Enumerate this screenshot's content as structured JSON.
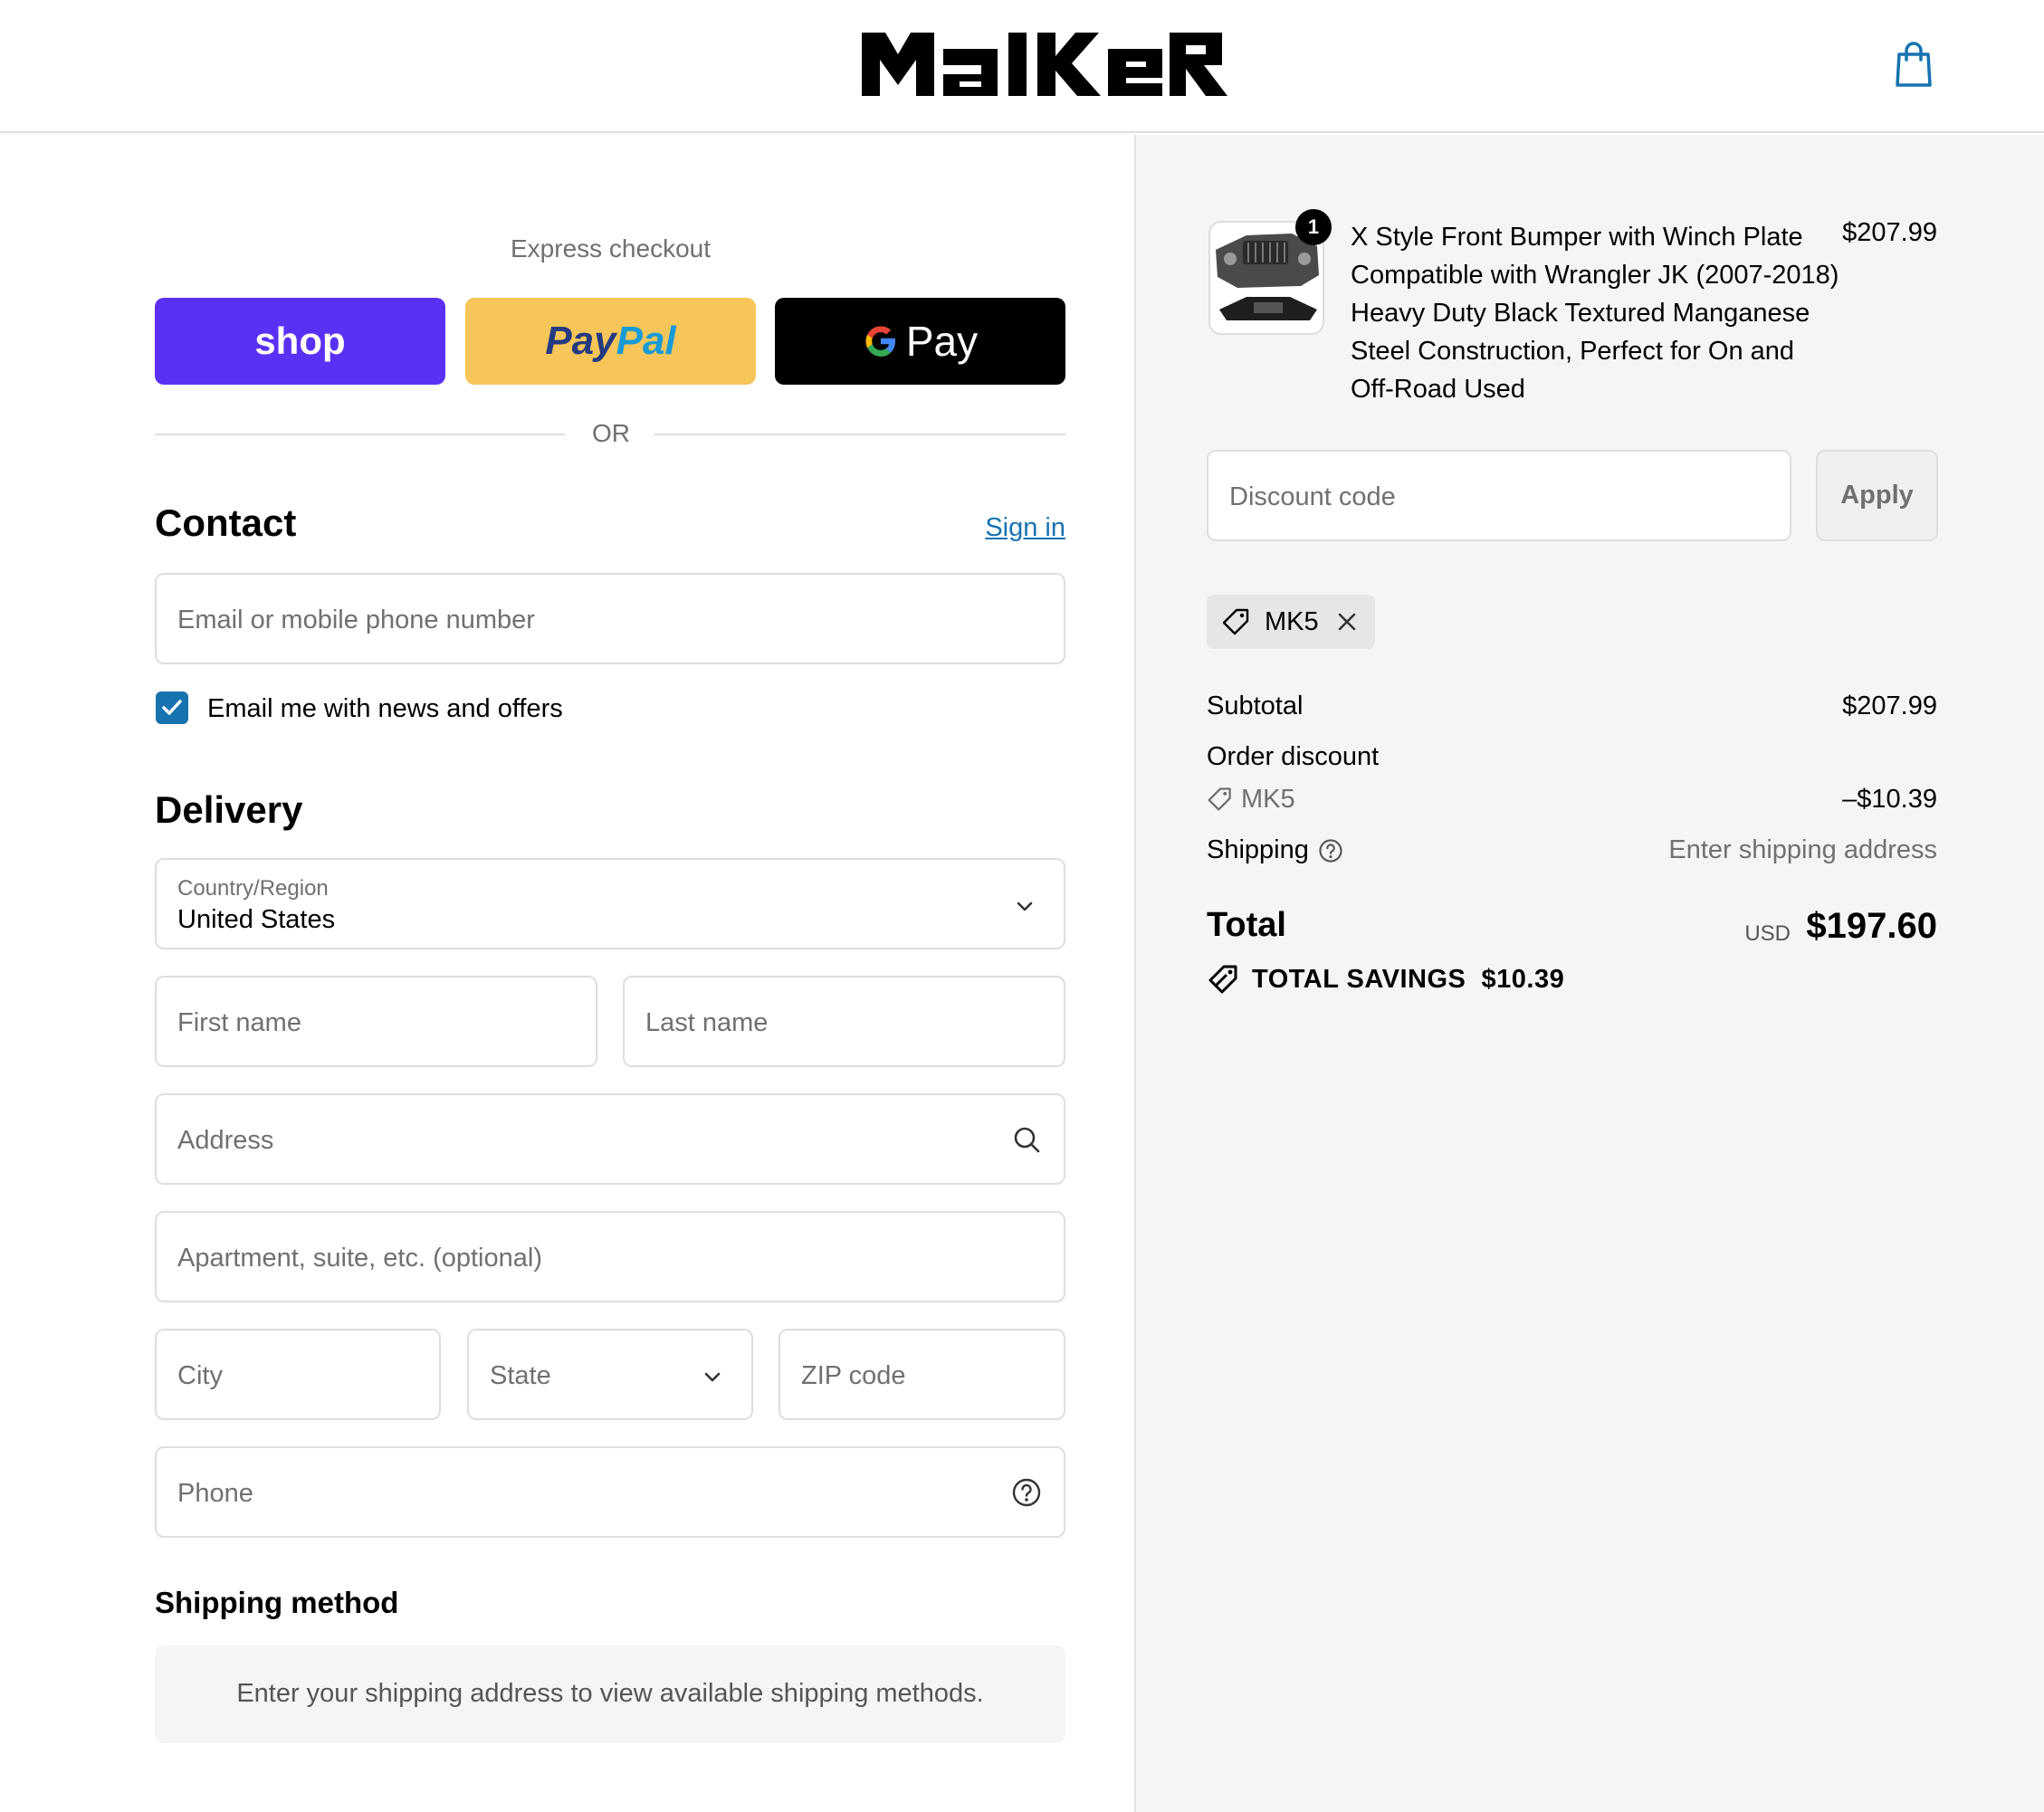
{
  "header": {
    "brand": "MAIKER",
    "cart_icon": "shopping-bag-icon"
  },
  "express": {
    "title": "Express checkout",
    "shop_label": "shop",
    "paypal_label_1": "Pay",
    "paypal_label_2": "Pal",
    "gpay_label": "Pay",
    "or_label": "OR"
  },
  "contact": {
    "heading": "Contact",
    "sign_in": "Sign in",
    "email_placeholder": "Email or mobile phone number",
    "newsletter_label": "Email me with news and offers",
    "newsletter_checked": true
  },
  "delivery": {
    "heading": "Delivery",
    "country_label": "Country/Region",
    "country_value": "United States",
    "first_name": "First name",
    "last_name": "Last name",
    "address": "Address",
    "apartment": "Apartment, suite, etc. (optional)",
    "city": "City",
    "state": "State",
    "zip": "ZIP code",
    "phone": "Phone"
  },
  "shipping_method": {
    "heading": "Shipping method",
    "message": "Enter your shipping address to view available shipping methods."
  },
  "summary": {
    "product": {
      "quantity": "1",
      "title": "X Style Front Bumper with Winch Plate Compatible with Wrangler JK (2007-2018) Heavy Duty Black Textured Manganese Steel Construction, Perfect for On and Off-Road Used",
      "price": "$207.99"
    },
    "discount_placeholder": "Discount code",
    "apply_label": "Apply",
    "applied_code": "MK5",
    "subtotal_label": "Subtotal",
    "subtotal_value": "$207.99",
    "order_discount_label": "Order discount",
    "discount_code": "MK5",
    "discount_value": "–$10.39",
    "shipping_label": "Shipping",
    "shipping_value": "Enter shipping address",
    "total_label": "Total",
    "currency": "USD",
    "total_value": "$197.60",
    "savings_label": "TOTAL SAVINGS",
    "savings_value": "$10.39"
  },
  "colors": {
    "shop_purple": "#5a31f4",
    "paypal_yellow": "#f7c65a",
    "link_blue": "#1773b0",
    "summary_bg": "#f5f5f5"
  }
}
